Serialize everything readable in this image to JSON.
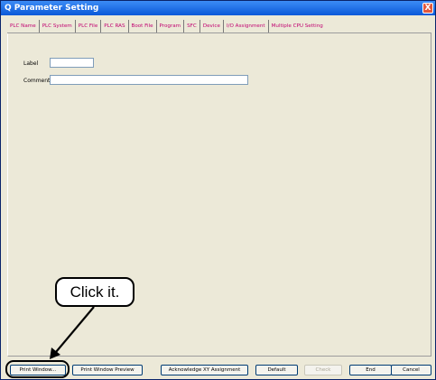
{
  "window": {
    "title": "Q Parameter Setting",
    "close_label": "X"
  },
  "tabs": [
    "PLC Name",
    "PLC System",
    "PLC File",
    "PLC RAS",
    "Boot File",
    "Program",
    "SFC",
    "Device",
    "I/O Assignment",
    "Multiple CPU Setting"
  ],
  "form": {
    "label_text": "Label",
    "label_value": "",
    "comment_text": "Comment",
    "comment_value": ""
  },
  "buttons": {
    "print_window": "Print Window...",
    "print_preview": "Print Window Preview",
    "acknowledge": "Acknowledge XY Assignment",
    "default": "Default",
    "check": "Check",
    "end": "End",
    "cancel": "Cancel"
  },
  "callout": {
    "text": "Click it."
  }
}
